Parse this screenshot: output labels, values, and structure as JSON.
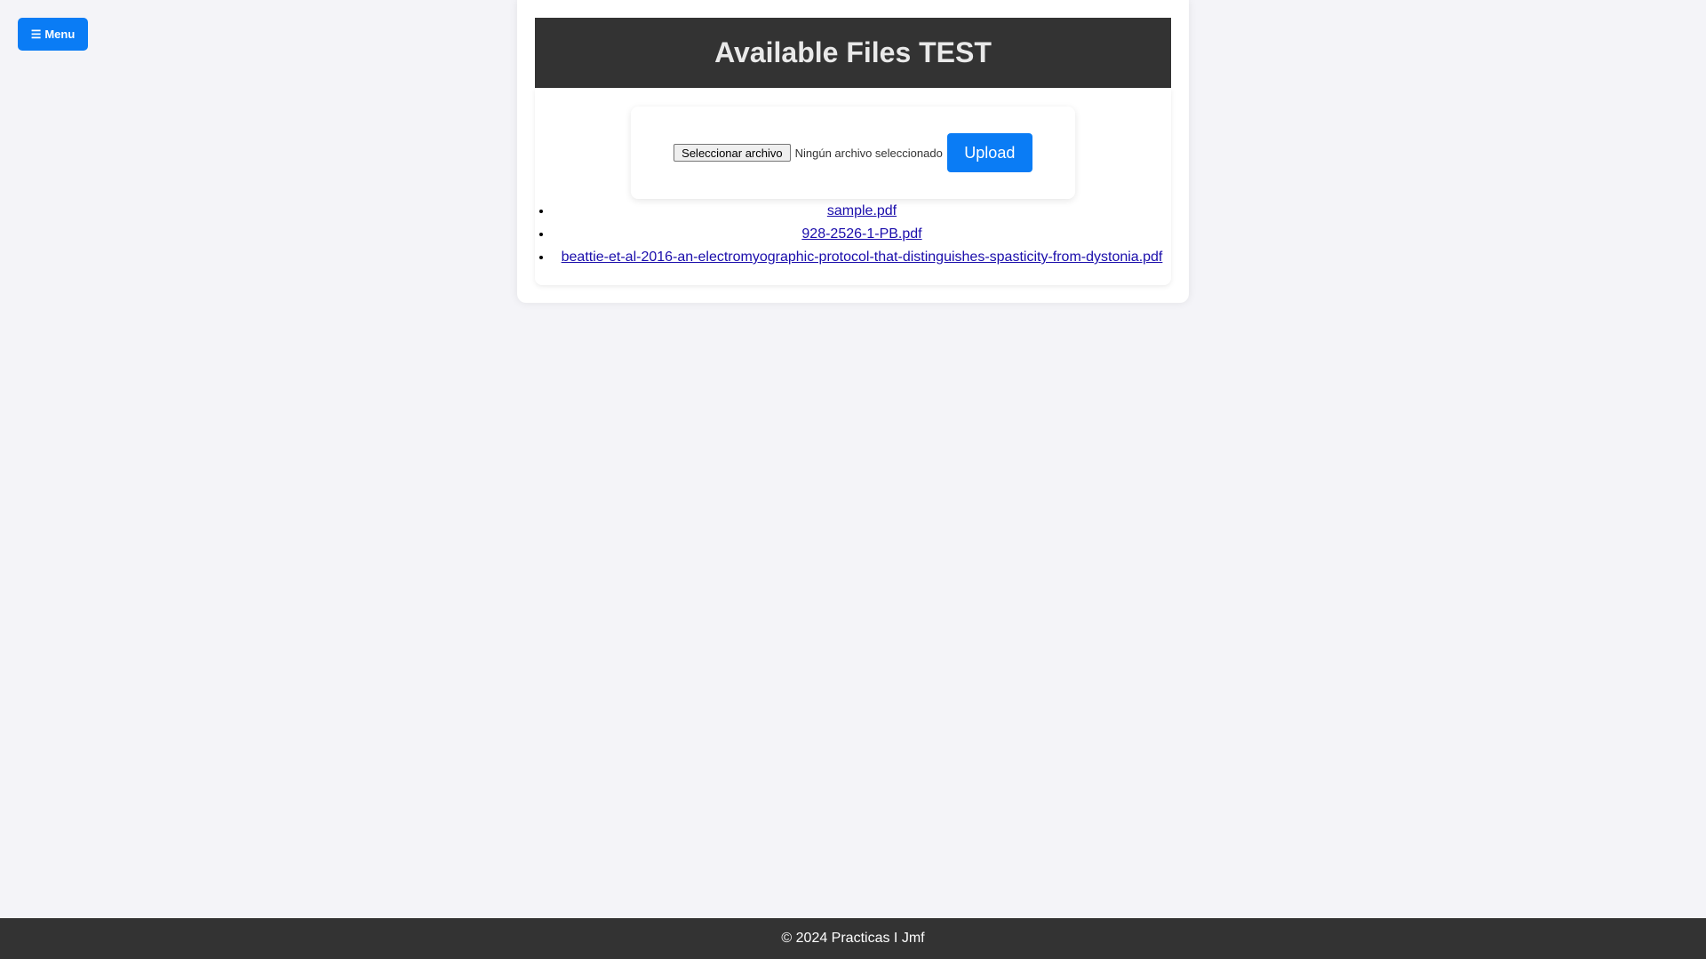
{
  "menu": {
    "icon": "hamburger-icon",
    "icon_glyph": "☰",
    "label": "Menu"
  },
  "header": {
    "title": "Available Files TEST"
  },
  "upload": {
    "choose_file_label": "Seleccionar archivo",
    "file_status": "Ningún archivo seleccionado",
    "upload_label": "Upload"
  },
  "files": [
    {
      "name": "sample.pdf"
    },
    {
      "name": "928-2526-1-PB.pdf"
    },
    {
      "name": "beattie-et-al-2016-an-electromyographic-protocol-that-distinguishes-spasticity-from-dystonia.pdf"
    }
  ],
  "footer": {
    "text": "© 2024 Practicas I Jmf"
  },
  "colors": {
    "accent": "#0a7cf5",
    "header_bg": "#333333",
    "page_bg": "#f4f4f8",
    "link": "#1a0dab"
  }
}
